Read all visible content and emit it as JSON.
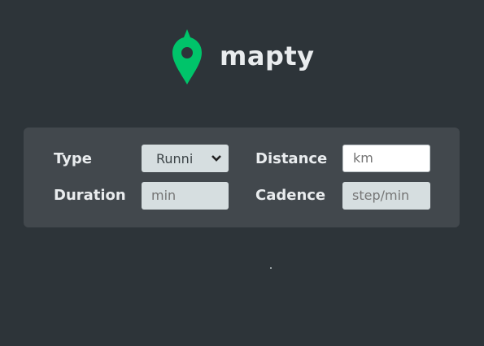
{
  "app": {
    "brand": "mapty",
    "brand_color": "#00c46a"
  },
  "form": {
    "type_label": "Type",
    "type_selected": "Runni",
    "distance_label": "Distance",
    "distance_placeholder": "km",
    "duration_label": "Duration",
    "duration_placeholder": "min",
    "cadence_label": "Cadence",
    "cadence_placeholder": "step/min"
  },
  "icons": {
    "logo": "map-pin-icon",
    "select": "chevron-down-icon"
  },
  "colors": {
    "background": "#2d3439",
    "form_background": "#42484d",
    "input_background": "#d6dee0",
    "text": "#e9ecee"
  }
}
